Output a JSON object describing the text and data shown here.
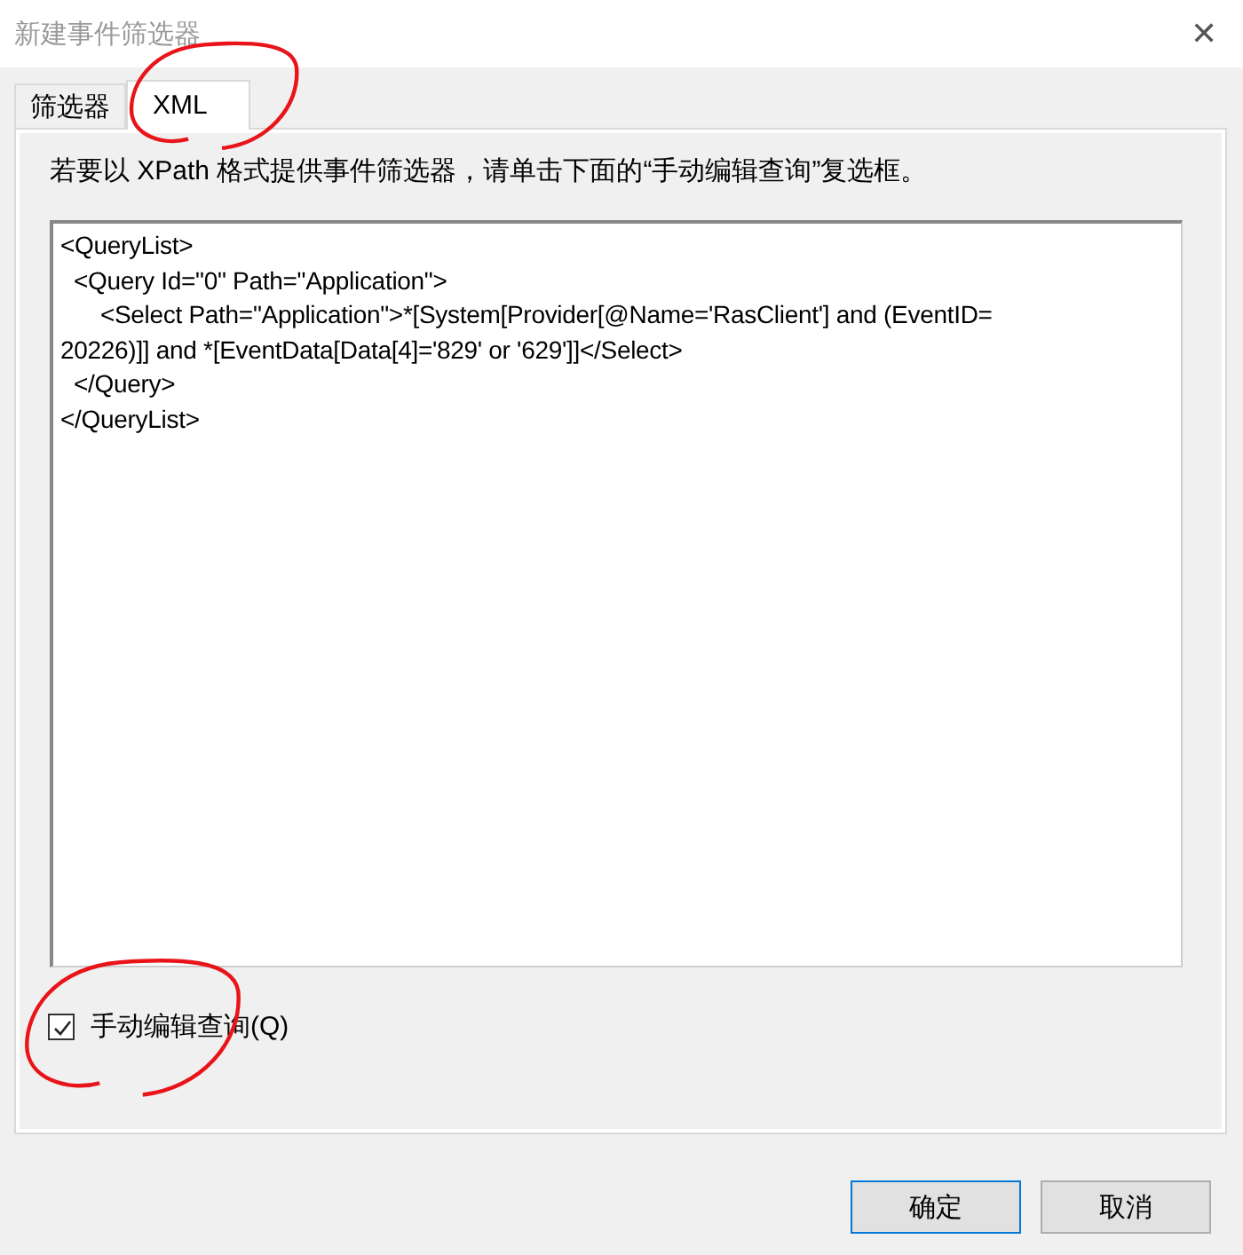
{
  "window": {
    "title": "新建事件筛选器",
    "close": "✕"
  },
  "tabs": [
    {
      "label": "筛选器",
      "selected": false,
      "circled": false
    },
    {
      "label": "XML",
      "selected": true,
      "circled": true
    }
  ],
  "instruction": "若要以 XPath 格式提供事件筛选器，请单击下面的“手动编辑查询”复选框。",
  "query_editor": {
    "lines": [
      "<QueryList>",
      "  <Query Id=\"0\" Path=\"Application\">",
      "      <Select Path=\"Application\">*[System[Provider[@Name='RasClient'] and (EventID=",
      "20226)]] and *[EventData[Data[4]='829' or '629']]</Select>",
      "  </Query>",
      "</QueryList>"
    ]
  },
  "manual_edit": {
    "label": "手动编辑查询(Q)",
    "checked": true,
    "circled": true
  },
  "buttons": [
    {
      "label": "确定",
      "default": true
    },
    {
      "label": "取消",
      "default": false
    }
  ]
}
